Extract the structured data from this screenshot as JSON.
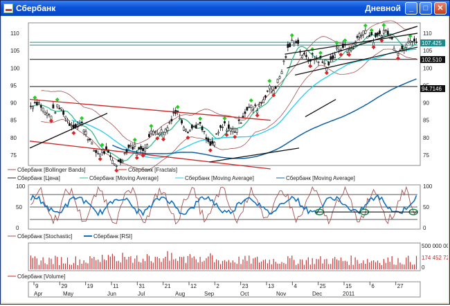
{
  "window": {
    "title": "Сбербанк",
    "mode": "Дневной"
  },
  "colors": {
    "up": "#22cc22",
    "down": "#dd2222",
    "price": "#1b1b1b",
    "bollinger": "#a05050",
    "ma_short": "#33bb88",
    "ma_mid": "#22ccee",
    "ma_long": "#1060a0",
    "rsi": "#1070c0",
    "stoch": "#a05050"
  },
  "price_axis": {
    "labels": [
      "110",
      "105",
      "100",
      "95",
      "90",
      "85",
      "80",
      "75"
    ],
    "tags": [
      "107.425",
      "105",
      "102.510",
      "94.7146"
    ]
  },
  "legend_main": [
    [
      "Сбербанк [Bollinger Bands]",
      "Сбербанк [Fractals]"
    ],
    [
      "Сбербанк [Цена]",
      "Сбербанк [Moving Average]",
      "Сбербанк [Moving Average]",
      "Сбербанк [Moving Average]"
    ]
  ],
  "oscillator_axis": {
    "labels": [
      "100",
      "50",
      "0"
    ]
  },
  "legend_osc": [
    "Сбербанк [Stochastic]",
    "Сбербанк [RSI]"
  ],
  "volume_axis": {
    "labels": [
      "500 000 000",
      "0"
    ],
    "tag": "174 452 72"
  },
  "legend_vol": [
    "Сбербанк [Volume]"
  ],
  "time_axis": {
    "days": [
      "9",
      "29",
      "19",
      "11",
      "31",
      "21",
      "12",
      "2",
      "23",
      "13",
      "4",
      "25",
      "15",
      "6",
      "27"
    ],
    "months": [
      "Apr",
      "May",
      "Jun",
      "Jul",
      "Aug",
      "Sep",
      "Oct",
      "Nov",
      "Dec",
      "2011"
    ]
  }
}
